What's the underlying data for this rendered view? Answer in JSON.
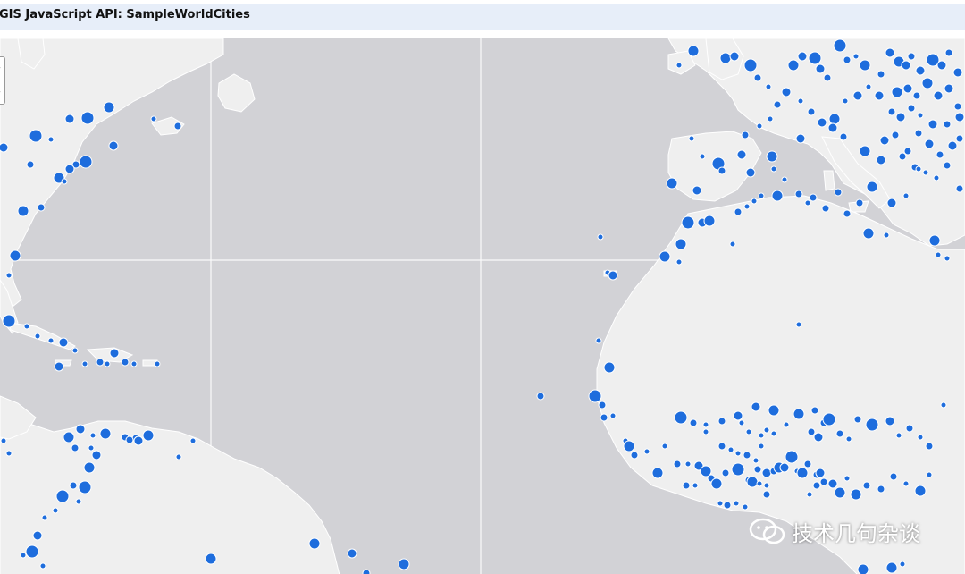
{
  "header": {
    "title": "GIS JavaScript API: SampleWorldCities"
  },
  "map": {
    "zoom_in_label": "+",
    "zoom_out_label": "−",
    "colors": {
      "water": "#d2d2d6",
      "land": "#efefef",
      "land_border": "#ffffff",
      "graticule": "#ffffff",
      "city": "#1e6ddd",
      "city_outline": "#ffffff"
    },
    "layer": "SampleWorldCities"
  },
  "watermark": {
    "text": "技术几句杂谈",
    "icon": "wechat-icon"
  }
}
